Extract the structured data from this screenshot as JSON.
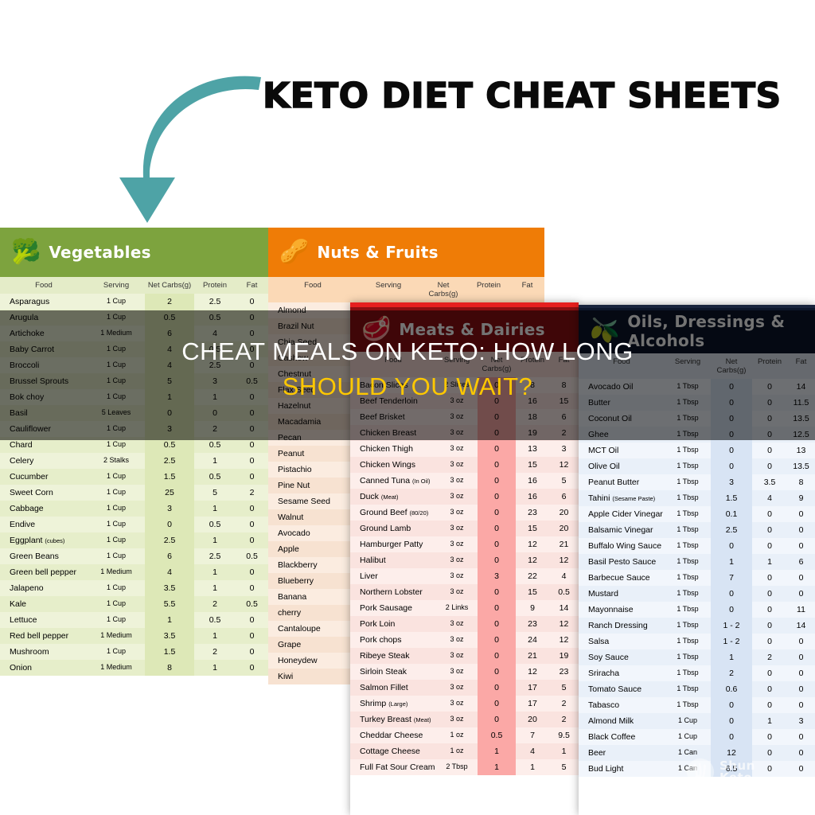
{
  "header": {
    "title": "KETO DIET CHEAT SHEETS",
    "arrow_color": "#4ea3a6"
  },
  "caption": {
    "line1": "CHEAT MEALS ON KETO: HOW LONG",
    "line2": "SHOULD YOU WAIT?",
    "line1_color": "#ffffff",
    "line2_color": "#ffc800"
  },
  "watermark": {
    "brand_line1": "Shun",
    "brand_line2": "Keto"
  },
  "columns": [
    "Food",
    "Serving",
    "Net Carbs(g)",
    "Protein",
    "Fat"
  ],
  "panels": [
    {
      "id": "vegetables",
      "title": "Vegetables",
      "icon": "broccoli-icon",
      "header_color": "#7da33e",
      "rows": [
        [
          "Asparagus",
          "1 Cup",
          "2",
          "2.5",
          "0"
        ],
        [
          "Arugula",
          "1 Cup",
          "0.5",
          "0.5",
          "0"
        ],
        [
          "Artichoke",
          "1 Medium",
          "6",
          "4",
          "0"
        ],
        [
          "Baby Carrot",
          "1 Cup",
          "4",
          "0.5",
          "0"
        ],
        [
          "Broccoli",
          "1 Cup",
          "4",
          "2.5",
          "0"
        ],
        [
          "Brussel Sprouts",
          "1 Cup",
          "5",
          "3",
          "0.5"
        ],
        [
          "Bok choy",
          "1 Cup",
          "1",
          "1",
          "0"
        ],
        [
          "Basil",
          "5 Leaves",
          "0",
          "0",
          "0"
        ],
        [
          "Cauliflower",
          "1 Cup",
          "3",
          "2",
          "0"
        ],
        [
          "Chard",
          "1 Cup",
          "0.5",
          "0.5",
          "0"
        ],
        [
          "Celery",
          "2 Stalks",
          "2.5",
          "1",
          "0"
        ],
        [
          "Cucumber",
          "1 Cup",
          "1.5",
          "0.5",
          "0"
        ],
        [
          "Sweet Corn",
          "1 Cup",
          "25",
          "5",
          "2"
        ],
        [
          "Cabbage",
          "1 Cup",
          "3",
          "1",
          "0"
        ],
        [
          "Endive",
          "1 Cup",
          "0",
          "0.5",
          "0"
        ],
        [
          "Eggplant (cubes)",
          "1 Cup",
          "2.5",
          "1",
          "0"
        ],
        [
          "Green Beans",
          "1 Cup",
          "6",
          "2.5",
          "0.5"
        ],
        [
          "Green bell pepper",
          "1 Medium",
          "4",
          "1",
          "0"
        ],
        [
          "Jalapeno",
          "1 Cup",
          "3.5",
          "1",
          "0"
        ],
        [
          "Kale",
          "1 Cup",
          "5.5",
          "2",
          "0.5"
        ],
        [
          "Lettuce",
          "1 Cup",
          "1",
          "0.5",
          "0"
        ],
        [
          "Red bell pepper",
          "1 Medium",
          "3.5",
          "1",
          "0"
        ],
        [
          "Mushroom",
          "1 Cup",
          "1.5",
          "2",
          "0"
        ],
        [
          "Onion",
          "1 Medium",
          "8",
          "1",
          "0"
        ]
      ]
    },
    {
      "id": "nuts-fruits",
      "title": "Nuts & Fruits",
      "icon": "pistachio-icon",
      "header_color": "#ef7c06",
      "rows": [
        [
          "Almond",
          "",
          "",
          "",
          ""
        ],
        [
          "Brazil Nut",
          "",
          "",
          "",
          ""
        ],
        [
          "Chia Seed",
          "",
          "",
          "",
          ""
        ],
        [
          "Cashew",
          "",
          "",
          "",
          ""
        ],
        [
          "Chestnut",
          "",
          "",
          "",
          ""
        ],
        [
          "Flax Seed",
          "",
          "",
          "",
          ""
        ],
        [
          "Hazelnut",
          "",
          "",
          "",
          ""
        ],
        [
          "Macadamia",
          "",
          "",
          "",
          ""
        ],
        [
          "Pecan",
          "",
          "",
          "",
          ""
        ],
        [
          "Peanut",
          "",
          "",
          "",
          ""
        ],
        [
          "Pistachio",
          "",
          "",
          "",
          ""
        ],
        [
          "Pine Nut",
          "",
          "",
          "",
          ""
        ],
        [
          "Sesame Seed",
          "",
          "",
          "",
          ""
        ],
        [
          "Walnut",
          "",
          "",
          "",
          ""
        ],
        [
          "Avocado",
          "",
          "",
          "",
          ""
        ],
        [
          "Apple",
          "",
          "",
          "",
          ""
        ],
        [
          "Blackberry",
          "",
          "",
          "",
          ""
        ],
        [
          "Blueberry",
          "",
          "",
          "",
          ""
        ],
        [
          "Banana",
          "",
          "",
          "",
          ""
        ],
        [
          "cherry",
          "",
          "",
          "",
          ""
        ],
        [
          "Cantaloupe",
          "",
          "",
          "",
          ""
        ],
        [
          "Grape",
          "",
          "",
          "",
          ""
        ],
        [
          "Honeydew",
          "",
          "",
          "",
          ""
        ],
        [
          "Kiwi",
          "",
          "",
          "",
          ""
        ]
      ]
    },
    {
      "id": "meats-dairies",
      "title": "Meats & Dairies",
      "icon": "steak-icon",
      "header_color": "#8c0f12",
      "rows": [
        [
          "Bacon Slices",
          "2 Slices",
          "0",
          "8",
          "8"
        ],
        [
          "Beef Tenderloin",
          "3 oz",
          "0",
          "16",
          "15"
        ],
        [
          "Beef Brisket",
          "3 oz",
          "0",
          "18",
          "6"
        ],
        [
          "Chicken Breast",
          "3 oz",
          "0",
          "19",
          "2"
        ],
        [
          "Chicken Thigh",
          "3 oz",
          "0",
          "13",
          "3"
        ],
        [
          "Chicken Wings",
          "3 oz",
          "0",
          "15",
          "12"
        ],
        [
          "Canned Tuna (In Oil)",
          "3 oz",
          "0",
          "16",
          "5"
        ],
        [
          "Duck (Meat)",
          "3 oz",
          "0",
          "16",
          "6"
        ],
        [
          "Ground Beef (80/20)",
          "3 oz",
          "0",
          "23",
          "20"
        ],
        [
          "Ground Lamb",
          "3 oz",
          "0",
          "15",
          "20"
        ],
        [
          "Hamburger Patty",
          "3 oz",
          "0",
          "12",
          "21"
        ],
        [
          "Halibut",
          "3 oz",
          "0",
          "12",
          "12"
        ],
        [
          "Liver",
          "3 oz",
          "3",
          "22",
          "4"
        ],
        [
          "Northern Lobster",
          "3 oz",
          "0",
          "15",
          "0.5"
        ],
        [
          "Pork Sausage",
          "2 Links",
          "0",
          "9",
          "14"
        ],
        [
          "Pork Loin",
          "3 oz",
          "0",
          "23",
          "12"
        ],
        [
          "Pork chops",
          "3 oz",
          "0",
          "24",
          "12"
        ],
        [
          "Ribeye Steak",
          "3 oz",
          "0",
          "21",
          "19"
        ],
        [
          "Sirloin Steak",
          "3 oz",
          "0",
          "12",
          "23"
        ],
        [
          "Salmon Fillet",
          "3 oz",
          "0",
          "17",
          "5"
        ],
        [
          "Shrimp (Large)",
          "3 oz",
          "0",
          "17",
          "2"
        ],
        [
          "Turkey Breast (Meat)",
          "3 oz",
          "0",
          "20",
          "2"
        ],
        [
          "Cheddar Cheese",
          "1 oz",
          "0.5",
          "7",
          "9.5"
        ],
        [
          "Cottage Cheese",
          "1 oz",
          "1",
          "4",
          "1"
        ],
        [
          "Full Fat Sour Cream",
          "2 Tbsp",
          "1",
          "1",
          "5"
        ]
      ]
    },
    {
      "id": "oils-dressings-alcohols",
      "title": "Oils, Dressings & Alcohols",
      "icon": "olive-oil-bottle-icon",
      "header_color": "#0d162b",
      "rows": [
        [
          "Avocado Oil",
          "1 Tbsp",
          "0",
          "0",
          "14"
        ],
        [
          "Butter",
          "1 Tbsp",
          "0",
          "0",
          "11.5"
        ],
        [
          "Coconut Oil",
          "1 Tbsp",
          "0",
          "0",
          "13.5"
        ],
        [
          "Ghee",
          "1 Tbsp",
          "0",
          "0",
          "12.5"
        ],
        [
          "MCT Oil",
          "1 Tbsp",
          "0",
          "0",
          "13"
        ],
        [
          "Olive Oil",
          "1 Tbsp",
          "0",
          "0",
          "13.5"
        ],
        [
          "Peanut Butter",
          "1 Tbsp",
          "3",
          "3.5",
          "8"
        ],
        [
          "Tahini (Sesame Paste)",
          "1 Tbsp",
          "1.5",
          "4",
          "9"
        ],
        [
          "Apple Cider Vinegar",
          "1 Tbsp",
          "0.1",
          "0",
          "0"
        ],
        [
          "Balsamic Vinegar",
          "1 Tbsp",
          "2.5",
          "0",
          "0"
        ],
        [
          "Buffalo Wing Sauce",
          "1 Tbsp",
          "0",
          "0",
          "0"
        ],
        [
          "Basil Pesto Sauce",
          "1 Tbsp",
          "1",
          "1",
          "6"
        ],
        [
          "Barbecue Sauce",
          "1 Tbsp",
          "7",
          "0",
          "0"
        ],
        [
          "Mustard",
          "1 Tbsp",
          "0",
          "0",
          "0"
        ],
        [
          "Mayonnaise",
          "1 Tbsp",
          "0",
          "0",
          "11"
        ],
        [
          "Ranch Dressing",
          "1 Tbsp",
          "1 - 2",
          "0",
          "14"
        ],
        [
          "Salsa",
          "1 Tbsp",
          "1 - 2",
          "0",
          "0"
        ],
        [
          "Soy Sauce",
          "1 Tbsp",
          "1",
          "2",
          "0"
        ],
        [
          "Sriracha",
          "1 Tbsp",
          "2",
          "0",
          "0"
        ],
        [
          "Tomato Sauce",
          "1 Tbsp",
          "0.6",
          "0",
          "0"
        ],
        [
          "Tabasco",
          "1 Tbsp",
          "0",
          "0",
          "0"
        ],
        [
          "Almond Milk",
          "1 Cup",
          "0",
          "1",
          "3"
        ],
        [
          "Black Coffee",
          "1 Cup",
          "0",
          "0",
          "0"
        ],
        [
          "Beer",
          "1 Can",
          "12",
          "0",
          "0"
        ],
        [
          "Bud Light",
          "1 Can",
          "6.5",
          "0",
          "0"
        ]
      ]
    }
  ]
}
